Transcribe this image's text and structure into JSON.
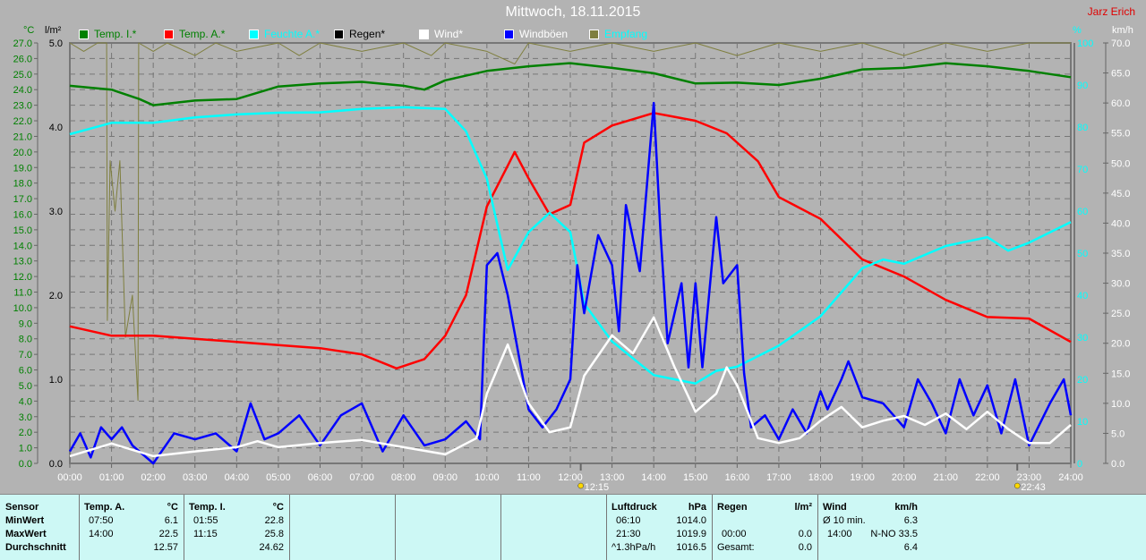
{
  "header": {
    "title": "Mittwoch, 18.11.2015",
    "author": "Jarz Erich"
  },
  "legend": [
    {
      "label": "Temp. I.*",
      "color": "#008000",
      "text": "#008000"
    },
    {
      "label": "Temp. A.*",
      "color": "#ff0000",
      "text": "#008000"
    },
    {
      "label": "Feuchte A.*",
      "color": "#00ffff",
      "text": "#00ffff"
    },
    {
      "label": "Regen*",
      "color": "#000000",
      "text": "#000000"
    },
    {
      "label": "Wind*",
      "color": "#ffffff",
      "text": "#ffffff"
    },
    {
      "label": "Windböen",
      "color": "#0000ff",
      "text": "#ffffff"
    },
    {
      "label": "Empfang",
      "color": "#7f7f3f",
      "text": "#00ffff"
    }
  ],
  "chart_data": {
    "type": "line",
    "title": "Mittwoch, 18.11.2015",
    "axes": {
      "temp": {
        "unit": "°C",
        "range": [
          0,
          27
        ],
        "step": 1,
        "color": "#008000"
      },
      "rain": {
        "unit": "l/m²",
        "range": [
          0,
          5
        ],
        "step": 1
      },
      "humidity": {
        "unit": "%",
        "range": [
          0,
          100
        ],
        "step": 10,
        "color": "#00ffff"
      },
      "wind": {
        "unit": "km/h",
        "range": [
          0,
          70
        ],
        "step": 5
      }
    },
    "x_ticks": [
      "00:00",
      "01:00",
      "02:00",
      "03:00",
      "04:00",
      "05:00",
      "06:00",
      "07:00",
      "08:00",
      "09:00",
      "10:00",
      "11:00",
      "12:00",
      "13:00",
      "14:00",
      "15:00",
      "16:00",
      "17:00",
      "18:00",
      "19:00",
      "20:00",
      "21:00",
      "22:00",
      "23:00",
      "24:00"
    ],
    "annotations": [
      {
        "time": "12:15",
        "label": "12:15"
      },
      {
        "time": "22:43",
        "label": "22:43"
      }
    ],
    "series": [
      {
        "name": "Empfang",
        "axis": "humidity",
        "color": "#7f7f3f",
        "points": [
          [
            "00:00",
            100
          ],
          [
            "00:20",
            98
          ],
          [
            "00:40",
            100
          ],
          [
            "00:53",
            100
          ],
          [
            "00:54",
            34
          ],
          [
            "00:58",
            72
          ],
          [
            "01:05",
            60
          ],
          [
            "01:12",
            72
          ],
          [
            "01:20",
            30
          ],
          [
            "01:30",
            40
          ],
          [
            "01:38",
            15
          ],
          [
            "01:39",
            100
          ],
          [
            "02:00",
            98
          ],
          [
            "02:20",
            100
          ],
          [
            "03:00",
            97
          ],
          [
            "03:30",
            100
          ],
          [
            "04:00",
            98
          ],
          [
            "05:00",
            100
          ],
          [
            "05:30",
            97
          ],
          [
            "06:00",
            100
          ],
          [
            "07:00",
            98
          ],
          [
            "08:00",
            100
          ],
          [
            "08:40",
            97
          ],
          [
            "09:00",
            100
          ],
          [
            "10:00",
            98
          ],
          [
            "10:40",
            95
          ],
          [
            "11:00",
            100
          ],
          [
            "12:00",
            98
          ],
          [
            "13:00",
            100
          ],
          [
            "14:00",
            98
          ],
          [
            "15:00",
            100
          ],
          [
            "16:00",
            97
          ],
          [
            "17:00",
            100
          ],
          [
            "18:00",
            98
          ],
          [
            "19:00",
            100
          ],
          [
            "20:00",
            97
          ],
          [
            "21:00",
            100
          ],
          [
            "22:00",
            98
          ],
          [
            "23:00",
            100
          ],
          [
            "24:00",
            100
          ]
        ]
      },
      {
        "name": "Temp. I.",
        "axis": "temp",
        "color": "#008000",
        "points": [
          [
            "00:00",
            24.25
          ],
          [
            "01:00",
            24.0
          ],
          [
            "01:40",
            23.4
          ],
          [
            "02:00",
            23.0
          ],
          [
            "03:00",
            23.3
          ],
          [
            "04:00",
            23.4
          ],
          [
            "05:00",
            24.2
          ],
          [
            "06:00",
            24.4
          ],
          [
            "07:00",
            24.5
          ],
          [
            "08:00",
            24.25
          ],
          [
            "08:30",
            24.0
          ],
          [
            "09:00",
            24.6
          ],
          [
            "10:00",
            25.2
          ],
          [
            "11:00",
            25.5
          ],
          [
            "12:00",
            25.7
          ],
          [
            "13:00",
            25.4
          ],
          [
            "14:00",
            25.05
          ],
          [
            "15:00",
            24.4
          ],
          [
            "16:00",
            24.45
          ],
          [
            "17:00",
            24.3
          ],
          [
            "18:00",
            24.7
          ],
          [
            "19:00",
            25.3
          ],
          [
            "20:00",
            25.4
          ],
          [
            "21:00",
            25.7
          ],
          [
            "22:00",
            25.5
          ],
          [
            "23:00",
            25.2
          ],
          [
            "24:00",
            24.8
          ]
        ]
      },
      {
        "name": "Temp. A.",
        "axis": "temp",
        "color": "#ff0000",
        "points": [
          [
            "00:00",
            8.8
          ],
          [
            "01:00",
            8.2
          ],
          [
            "02:00",
            8.2
          ],
          [
            "03:00",
            8.0
          ],
          [
            "04:00",
            7.8
          ],
          [
            "05:00",
            7.6
          ],
          [
            "06:00",
            7.4
          ],
          [
            "07:00",
            7.0
          ],
          [
            "07:50",
            6.1
          ],
          [
            "08:30",
            6.7
          ],
          [
            "09:00",
            8.2
          ],
          [
            "09:30",
            10.8
          ],
          [
            "10:00",
            16.5
          ],
          [
            "10:40",
            20.0
          ],
          [
            "11:00",
            18.3
          ],
          [
            "11:30",
            16.0
          ],
          [
            "12:00",
            16.6
          ],
          [
            "12:20",
            20.6
          ],
          [
            "13:00",
            21.7
          ],
          [
            "14:00",
            22.5
          ],
          [
            "15:00",
            22.0
          ],
          [
            "15:45",
            21.2
          ],
          [
            "16:30",
            19.4
          ],
          [
            "17:00",
            17.1
          ],
          [
            "18:00",
            15.7
          ],
          [
            "19:00",
            13.1
          ],
          [
            "20:00",
            12.0
          ],
          [
            "21:00",
            10.5
          ],
          [
            "22:00",
            9.4
          ],
          [
            "23:00",
            9.3
          ],
          [
            "24:00",
            7.8
          ]
        ]
      },
      {
        "name": "Feuchte A.",
        "axis": "humidity",
        "color": "#00ffff",
        "points": [
          [
            "00:00",
            78.3
          ],
          [
            "01:00",
            81
          ],
          [
            "02:00",
            81
          ],
          [
            "03:00",
            82.3
          ],
          [
            "04:00",
            83
          ],
          [
            "05:00",
            83.4
          ],
          [
            "06:00",
            83.5
          ],
          [
            "07:00",
            84.3
          ],
          [
            "08:00",
            84.7
          ],
          [
            "09:00",
            84.3
          ],
          [
            "09:30",
            79
          ],
          [
            "10:00",
            67.7
          ],
          [
            "10:30",
            46
          ],
          [
            "11:00",
            55
          ],
          [
            "11:30",
            59.6
          ],
          [
            "12:00",
            55
          ],
          [
            "12:20",
            38
          ],
          [
            "13:00",
            29
          ],
          [
            "14:00",
            21
          ],
          [
            "15:00",
            19
          ],
          [
            "15:30",
            22
          ],
          [
            "16:00",
            23
          ],
          [
            "17:00",
            28
          ],
          [
            "18:00",
            35
          ],
          [
            "19:00",
            46.4
          ],
          [
            "19:30",
            48.5
          ],
          [
            "20:00",
            47.5
          ],
          [
            "21:00",
            51.7
          ],
          [
            "22:00",
            53.8
          ],
          [
            "22:30",
            50.6
          ],
          [
            "23:00",
            52.5
          ],
          [
            "24:00",
            57.4
          ]
        ]
      },
      {
        "name": "Windböen",
        "axis": "wind",
        "color": "#0000ff",
        "points": [
          [
            "00:00",
            2
          ],
          [
            "00:15",
            5
          ],
          [
            "00:30",
            1
          ],
          [
            "00:45",
            6
          ],
          [
            "01:00",
            4
          ],
          [
            "01:15",
            6
          ],
          [
            "01:30",
            3
          ],
          [
            "02:00",
            0
          ],
          [
            "02:30",
            5
          ],
          [
            "03:00",
            4
          ],
          [
            "03:30",
            5
          ],
          [
            "04:00",
            2
          ],
          [
            "04:20",
            10
          ],
          [
            "04:40",
            4
          ],
          [
            "05:00",
            5
          ],
          [
            "05:30",
            8
          ],
          [
            "06:00",
            3
          ],
          [
            "06:30",
            8
          ],
          [
            "07:00",
            10
          ],
          [
            "07:30",
            2
          ],
          [
            "08:00",
            8
          ],
          [
            "08:30",
            3
          ],
          [
            "09:00",
            4
          ],
          [
            "09:30",
            7
          ],
          [
            "09:50",
            4
          ],
          [
            "10:00",
            33
          ],
          [
            "10:15",
            35
          ],
          [
            "10:30",
            28
          ],
          [
            "11:00",
            9
          ],
          [
            "11:20",
            6
          ],
          [
            "11:40",
            9
          ],
          [
            "12:00",
            14
          ],
          [
            "12:10",
            33
          ],
          [
            "12:20",
            25
          ],
          [
            "12:40",
            38
          ],
          [
            "13:00",
            33
          ],
          [
            "13:10",
            22
          ],
          [
            "13:20",
            43
          ],
          [
            "13:40",
            32
          ],
          [
            "14:00",
            60
          ],
          [
            "14:10",
            38
          ],
          [
            "14:20",
            20
          ],
          [
            "14:40",
            30
          ],
          [
            "14:50",
            16
          ],
          [
            "15:00",
            30
          ],
          [
            "15:10",
            16
          ],
          [
            "15:30",
            41
          ],
          [
            "15:40",
            30
          ],
          [
            "16:00",
            33
          ],
          [
            "16:10",
            15
          ],
          [
            "16:20",
            6
          ],
          [
            "16:40",
            8
          ],
          [
            "17:00",
            4
          ],
          [
            "17:20",
            9
          ],
          [
            "17:40",
            5
          ],
          [
            "18:00",
            12
          ],
          [
            "18:10",
            9
          ],
          [
            "18:30",
            14
          ],
          [
            "18:40",
            17
          ],
          [
            "19:00",
            11
          ],
          [
            "19:30",
            10
          ],
          [
            "20:00",
            6
          ],
          [
            "20:20",
            14
          ],
          [
            "20:40",
            10
          ],
          [
            "21:00",
            5
          ],
          [
            "21:20",
            14
          ],
          [
            "21:40",
            8
          ],
          [
            "22:00",
            13
          ],
          [
            "22:20",
            5
          ],
          [
            "22:40",
            14
          ],
          [
            "23:00",
            3
          ],
          [
            "23:30",
            10
          ],
          [
            "23:50",
            14
          ],
          [
            "24:00",
            8
          ]
        ]
      },
      {
        "name": "Wind",
        "axis": "wind",
        "color": "#ffffff",
        "points": [
          [
            "00:00",
            1.2
          ],
          [
            "01:00",
            3.3
          ],
          [
            "02:00",
            1.2
          ],
          [
            "03:00",
            2.0
          ],
          [
            "04:00",
            2.7
          ],
          [
            "04:30",
            3.7
          ],
          [
            "05:00",
            2.7
          ],
          [
            "06:00",
            3.4
          ],
          [
            "07:00",
            3.9
          ],
          [
            "08:00",
            2.7
          ],
          [
            "09:00",
            1.5
          ],
          [
            "09:45",
            4.2
          ],
          [
            "10:00",
            11.6
          ],
          [
            "10:30",
            19.8
          ],
          [
            "11:00",
            10
          ],
          [
            "11:30",
            5.2
          ],
          [
            "12:00",
            6
          ],
          [
            "12:20",
            14.6
          ],
          [
            "13:00",
            21.3
          ],
          [
            "13:30",
            18.3
          ],
          [
            "14:00",
            24.3
          ],
          [
            "14:30",
            16
          ],
          [
            "15:00",
            8.6
          ],
          [
            "15:30",
            11.6
          ],
          [
            "15:45",
            16
          ],
          [
            "16:00",
            13
          ],
          [
            "16:30",
            4.2
          ],
          [
            "17:00",
            3.4
          ],
          [
            "17:30",
            4.2
          ],
          [
            "18:00",
            7.1
          ],
          [
            "18:30",
            9.4
          ],
          [
            "19:00",
            6
          ],
          [
            "19:30",
            7.1
          ],
          [
            "20:00",
            7.9
          ],
          [
            "20:30",
            6.4
          ],
          [
            "21:00",
            8.3
          ],
          [
            "21:30",
            5.7
          ],
          [
            "22:00",
            8.6
          ],
          [
            "22:30",
            5.7
          ],
          [
            "23:00",
            3.4
          ],
          [
            "23:30",
            3.4
          ],
          [
            "24:00",
            6.4
          ]
        ]
      }
    ]
  },
  "stats": {
    "temp_a": {
      "sensor": "Sensor",
      "title": "Temp. A.",
      "unit": "°C",
      "min_label": "MinWert",
      "max_label": "MaxWert",
      "avg_label": "Durchschnitt",
      "min_time": "07:50",
      "min": "6.1",
      "max_time": "14:00",
      "max": "22.5",
      "avg": "12.57"
    },
    "temp_i": {
      "title": "Temp. I.",
      "unit": "°C",
      "min_time": "01:55",
      "min": "22.8",
      "max_time": "11:15",
      "max": "25.8",
      "avg": "24.62"
    },
    "pressure": {
      "title": "Luftdruck",
      "unit": "hPa",
      "min_time": "06:10",
      "min": "1014.0",
      "max_time": "21:30",
      "max": "1019.9",
      "trend": "^1.3hPa/h",
      "current": "1016.5"
    },
    "rain": {
      "title": "Regen",
      "unit": "l/m²",
      "time": "00:00",
      "value": "0.0",
      "total_label": "Gesamt:",
      "total": "0.0"
    },
    "wind": {
      "title": "Wind",
      "unit": "km/h",
      "avg10_label": "Ø 10 min.",
      "avg10": "6.3",
      "max_time": "14:00",
      "max": "N-NO 33.5",
      "avg": "6.4"
    }
  }
}
